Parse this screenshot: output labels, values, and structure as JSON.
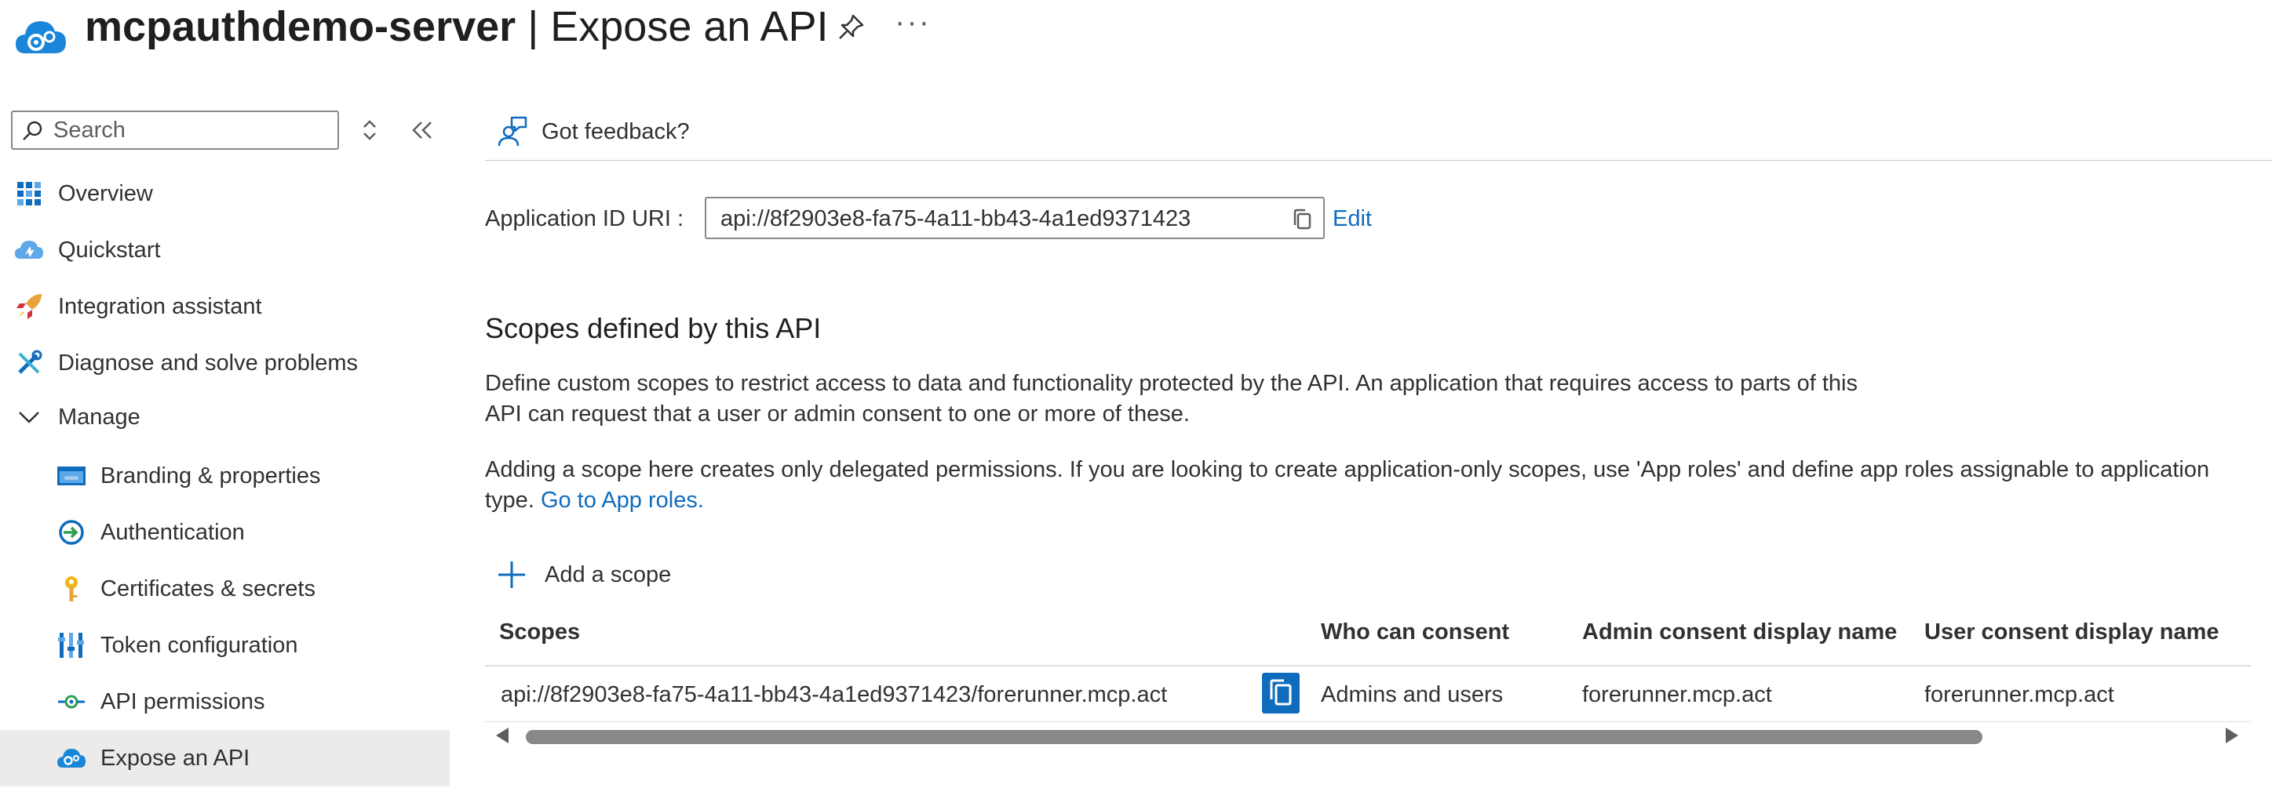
{
  "header": {
    "app_name": "mcpauthdemo-server",
    "separator": " | ",
    "page_name": "Expose an API",
    "pin_icon": "pin-icon",
    "more_label": "···"
  },
  "sidebar": {
    "search_placeholder": "Search",
    "items": [
      {
        "label": "Overview",
        "icon": "overview-grid-icon"
      },
      {
        "label": "Quickstart",
        "icon": "quickstart-cloud-icon"
      },
      {
        "label": "Integration assistant",
        "icon": "rocket-icon"
      },
      {
        "label": "Diagnose and solve problems",
        "icon": "wrench-icon"
      },
      {
        "label": "Manage",
        "icon": "chevron-down-icon"
      },
      {
        "label": "Branding & properties",
        "icon": "branding-icon"
      },
      {
        "label": "Authentication",
        "icon": "authentication-icon"
      },
      {
        "label": "Certificates & secrets",
        "icon": "key-icon"
      },
      {
        "label": "Token configuration",
        "icon": "token-icon"
      },
      {
        "label": "API permissions",
        "icon": "api-permissions-icon"
      },
      {
        "label": "Expose an API",
        "icon": "expose-api-icon",
        "selected": true
      }
    ]
  },
  "main": {
    "feedback_label": "Got feedback?",
    "app_id_label": "Application ID URI :",
    "app_id_value": "api://8f2903e8-fa75-4a11-bb43-4a1ed9371423",
    "edit_label": "Edit",
    "scopes_heading": "Scopes defined by this API",
    "desc_line1": "Define custom scopes to restrict access to data and functionality protected by the API. An application that requires access to parts of this",
    "desc_line2": "API can request that a user or admin consent to one or more of these.",
    "note_line1": "Adding a scope here creates only delegated permissions. If you are looking to create application-only scopes, use 'App roles' and define app roles assignable to application",
    "note_line2_prefix": "type.",
    "note_link": "Go to App roles.",
    "add_scope_label": "Add a scope",
    "table": {
      "headers": [
        "Scopes",
        "Who can consent",
        "Admin consent display name",
        "User consent display name"
      ],
      "rows": [
        {
          "scope": "api://8f2903e8-fa75-4a11-bb43-4a1ed9371423/forerunner.mcp.act",
          "who": "Admins and users",
          "admin_name": "forerunner.mcp.act",
          "user_name": "forerunner.mcp.act"
        }
      ]
    }
  },
  "colors": {
    "accent": "#0f6cbd",
    "selected_bg": "#edebe9"
  }
}
